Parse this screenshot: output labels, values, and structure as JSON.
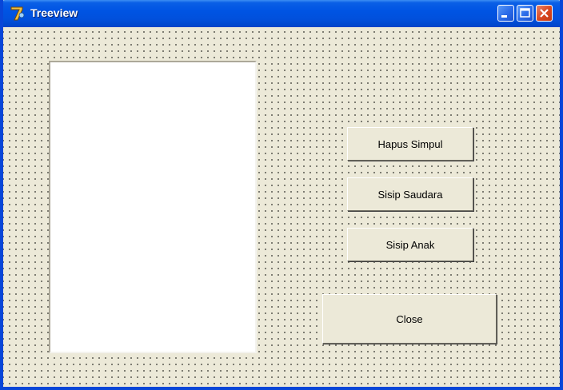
{
  "window": {
    "title": "Treeview",
    "icon": "delphi-app-icon"
  },
  "caption_buttons": {
    "minimize": "minimize-icon",
    "maximize": "maximize-icon",
    "close": "close-icon"
  },
  "colors": {
    "titlebar": "#0054e3",
    "face": "#ece9d8",
    "close_button": "#d8461e"
  },
  "buttons": {
    "hapus_simpul": "Hapus Simpul",
    "sisip_saudara": "Sisip Saudara",
    "sisip_anak": "Sisip Anak",
    "close": "Close"
  },
  "treeview": {
    "nodes": []
  }
}
